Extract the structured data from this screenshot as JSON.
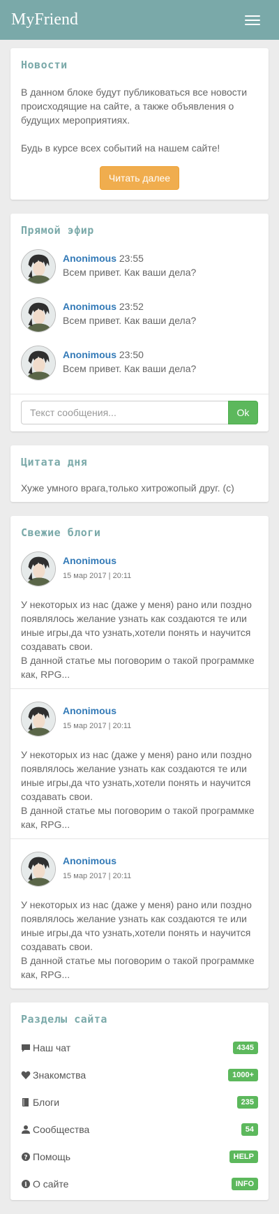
{
  "navbar": {
    "brand": "MyFriend"
  },
  "news": {
    "title": "Новости",
    "paragraph1": "В данном блоке будут публиковаться все новости происходящие на сайте, а также объявления о будущих мероприятиях.",
    "paragraph2": "Будь в курсе всех событий на нашем сайте!",
    "button": "Читать далее"
  },
  "live": {
    "title": "Прямой эфир",
    "messages": [
      {
        "name": "Anonimous",
        "time": "23:55",
        "text": "Всем привет. Как ваши дела?"
      },
      {
        "name": "Anonimous",
        "time": "23:52",
        "text": "Всем привет. Как ваши дела?"
      },
      {
        "name": "Anonimous",
        "time": "23:50",
        "text": "Всем привет. Как ваши дела?"
      }
    ],
    "placeholder": "Текст сообщения...",
    "send": "Ok"
  },
  "quote": {
    "title": "Цитата дня",
    "text": "Хуже умного врага,только хитрожопый друг. (с)"
  },
  "blogs": {
    "title": "Свежие блоги",
    "entries": [
      {
        "author": "Anonimous",
        "date": "15 мар 2017 | 20:11",
        "text1": "У некоторых из нас (даже у меня) рано или поздно появлялось желание узнать как создаются те или иные игры,да что узнать,хотели понять и научится создавать свои.",
        "text2": "В данной статье мы поговорим о такой программке как, RPG..."
      },
      {
        "author": "Anonimous",
        "date": "15 мар 2017 | 20:11",
        "text1": "У некоторых из нас (даже у меня) рано или поздно появлялось желание узнать как создаются те или иные игры,да что узнать,хотели понять и научится создавать свои.",
        "text2": "В данной статье мы поговорим о такой программке как, RPG..."
      },
      {
        "author": "Anonimous",
        "date": "15 мар 2017 | 20:11",
        "text1": "У некоторых из нас (даже у меня) рано или поздно появлялось желание узнать как создаются те или иные игры,да что узнать,хотели понять и научится создавать свои.",
        "text2": "В данной статье мы поговорим о такой программке как, RPG..."
      }
    ]
  },
  "sections": {
    "title": "Разделы сайта",
    "items": [
      {
        "label": "Наш чат",
        "badge": "4345",
        "icon": "comment-icon"
      },
      {
        "label": "Знакомства",
        "badge": "1000+",
        "icon": "heart-icon"
      },
      {
        "label": "Блоги",
        "badge": "235",
        "icon": "book-icon"
      },
      {
        "label": "Сообщества",
        "badge": "54",
        "icon": "user-icon"
      },
      {
        "label": "Помощь",
        "badge": "HELP",
        "icon": "question-icon"
      },
      {
        "label": "О сайте",
        "badge": "INFO",
        "icon": "info-icon"
      }
    ]
  },
  "colors": {
    "navbar": "#7aa9a9",
    "accent_title": "#7aa9a9",
    "button_warning": "#f0ad4e",
    "button_success": "#5cb85c",
    "link": "#337ab7"
  }
}
